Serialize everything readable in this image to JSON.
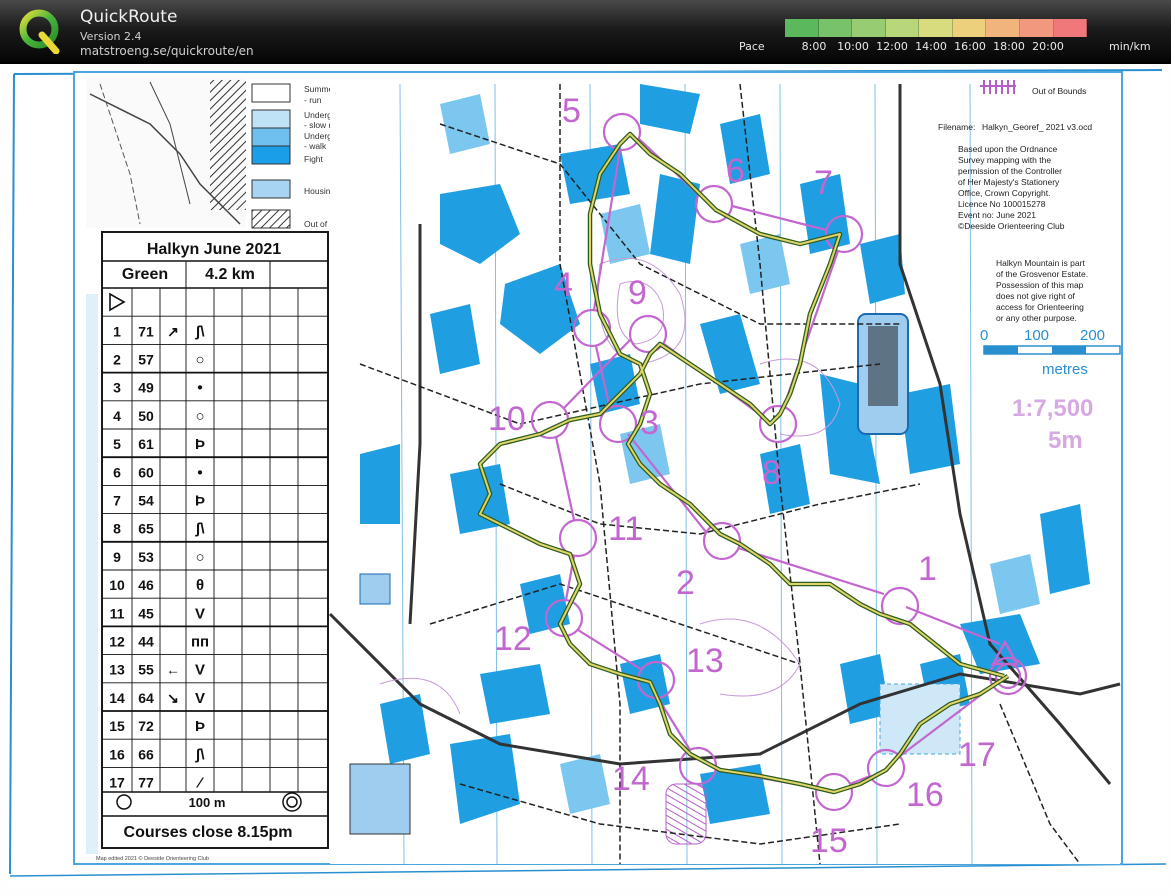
{
  "app": {
    "title": "QuickRoute",
    "version": "Version 2.4",
    "url": "matstroeng.se/quickroute/en",
    "logo_icon": "quickroute-q-logo-icon"
  },
  "pace": {
    "label": "Pace",
    "ticks": [
      "8:00",
      "10:00",
      "12:00",
      "14:00",
      "16:00",
      "18:00",
      "20:00"
    ],
    "unit": "min/km",
    "colors": [
      "#5cb85c",
      "#78c26a",
      "#98cc72",
      "#b8d67a",
      "#d8dc7e",
      "#ecd07c",
      "#f0b47c",
      "#f2987e",
      "#f0787a"
    ]
  },
  "map": {
    "legend": {
      "summer": "Summer undergrowth",
      "run": "- run",
      "undergrowth": "Undergrowth",
      "slow_run": "- slow run",
      "undergrowth2": "Undergrowth",
      "walk": "- walk",
      "fight": "Fight",
      "housing": "Housing",
      "oob": "Out of bounds",
      "oob2": "Out of Bounds"
    },
    "info": {
      "filename_label": "Filename:",
      "filename": "Halkyn_Georef_ 2021 v3.ocd",
      "lines": [
        "Based upon the Ordnance",
        "Survey mapping with the",
        "permission of the Controller",
        "of Her Majesty's Stationery",
        "Office, Crown Copyright.",
        "Licence No  100015278",
        "Event no: June 2021",
        "©Deeside Orienteering Club"
      ],
      "estate": [
        "Halkyn Mountain is part",
        "of the Grosvenor Estate.",
        "Possession of this map",
        "does not give right of",
        "access for Orienteering",
        "or any other purpose."
      ]
    },
    "scalebar": {
      "t0": "0",
      "t100": "100",
      "t200": "200",
      "unit": "metres",
      "scale": "1:7,500",
      "contour": "5m"
    },
    "control_numbers": [
      "5",
      "6",
      "7",
      "4",
      "9",
      "10",
      "3",
      "8",
      "11",
      "2",
      "1",
      "12",
      "13",
      "14",
      "17",
      "16",
      "15"
    ],
    "footer_credit": "Map edited 2021 © Deeside Orienteering Club"
  },
  "cd": {
    "title": "Halkyn June 2021",
    "course": "Green",
    "length": "4.2 km",
    "start_symbol": "triangle-start-icon",
    "rows": [
      {
        "n": "1",
        "code": "71",
        "dir": "↗",
        "feat": "ʃ\\"
      },
      {
        "n": "2",
        "code": "57",
        "dir": "",
        "feat": "○"
      },
      {
        "n": "3",
        "code": "49",
        "dir": "",
        "feat": "•"
      },
      {
        "n": "4",
        "code": "50",
        "dir": "",
        "feat": "○"
      },
      {
        "n": "5",
        "code": "61",
        "dir": "",
        "feat": "Þ"
      },
      {
        "n": "6",
        "code": "60",
        "dir": "",
        "feat": "•"
      },
      {
        "n": "7",
        "code": "54",
        "dir": "",
        "feat": "Þ"
      },
      {
        "n": "8",
        "code": "65",
        "dir": "",
        "feat": "ʃ\\"
      },
      {
        "n": "9",
        "code": "53",
        "dir": "",
        "feat": "○"
      },
      {
        "n": "10",
        "code": "46",
        "dir": "",
        "feat": "θ"
      },
      {
        "n": "11",
        "code": "45",
        "dir": "",
        "feat": "V"
      },
      {
        "n": "12",
        "code": "44",
        "dir": "",
        "feat": "ᴨᴨ"
      },
      {
        "n": "13",
        "code": "55",
        "dir": "←",
        "feat": "V"
      },
      {
        "n": "14",
        "code": "64",
        "dir": "↘",
        "feat": "V"
      },
      {
        "n": "15",
        "code": "72",
        "dir": "",
        "feat": "Þ"
      },
      {
        "n": "16",
        "code": "66",
        "dir": "",
        "feat": "ʃ\\"
      },
      {
        "n": "17",
        "code": "77",
        "dir": "",
        "feat": "⁄"
      }
    ],
    "finish_distance": "100 m",
    "closing": "Courses close 8.15pm"
  }
}
